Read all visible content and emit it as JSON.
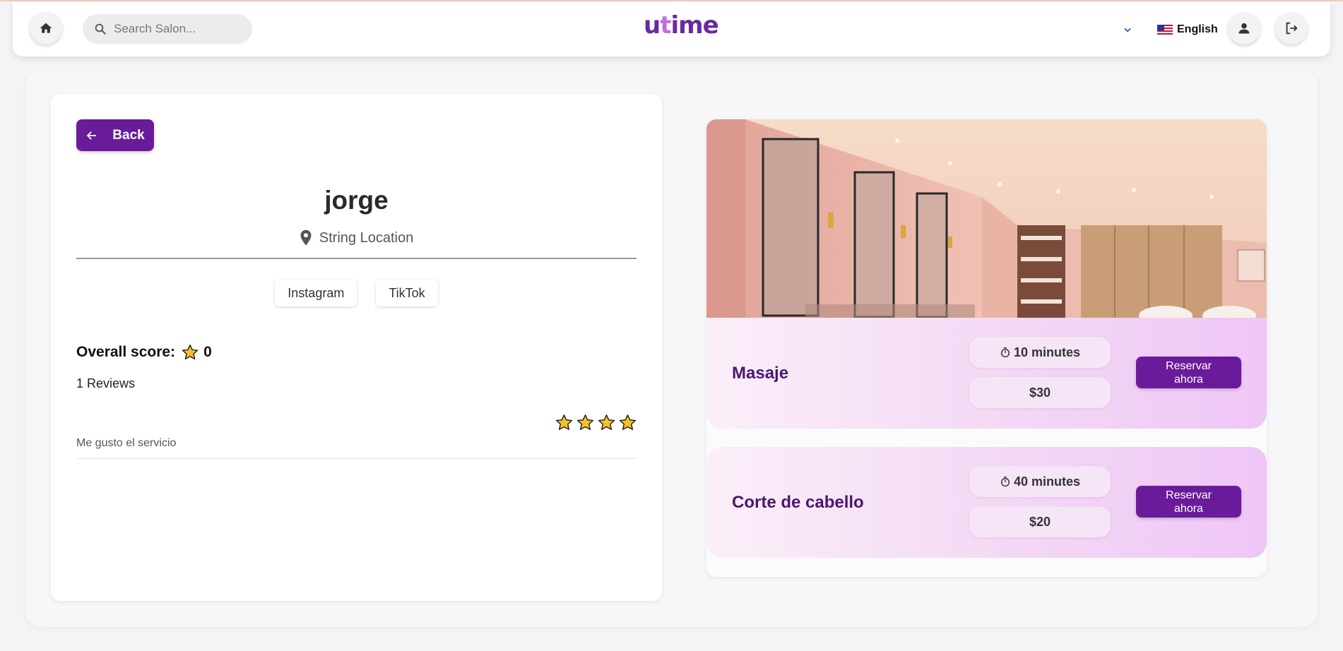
{
  "header": {
    "search_placeholder": "Search Salon...",
    "logo_text_a": "u",
    "logo_text_b": "t",
    "logo_text_c": "ime",
    "language_label": "English"
  },
  "salon": {
    "back_label": "Back",
    "name": "jorge",
    "location": "String Location",
    "socials": [
      "Instagram",
      "TikTok"
    ],
    "score_label": "Overall score:",
    "score_value": "0",
    "reviews_count": "1 Reviews",
    "review": {
      "rating": 4,
      "text": "Me gusto el servicio"
    }
  },
  "services": [
    {
      "name": "Masaje",
      "duration": "10 minutes",
      "price": "$30",
      "button_label": "Reservar ahora"
    },
    {
      "name": "Corte de cabello",
      "duration": "40 minutes",
      "price": "$20",
      "button_label": "Reservar ahora"
    }
  ],
  "colors": {
    "brand_purple": "#6a1b9a",
    "star_yellow": "#f6c12b"
  },
  "icons": [
    "home-icon",
    "search-icon",
    "chevron-down-icon",
    "us-flag-icon",
    "user-icon",
    "logout-icon",
    "arrow-left-icon",
    "location-pin-icon",
    "star-icon",
    "stopwatch-icon"
  ]
}
